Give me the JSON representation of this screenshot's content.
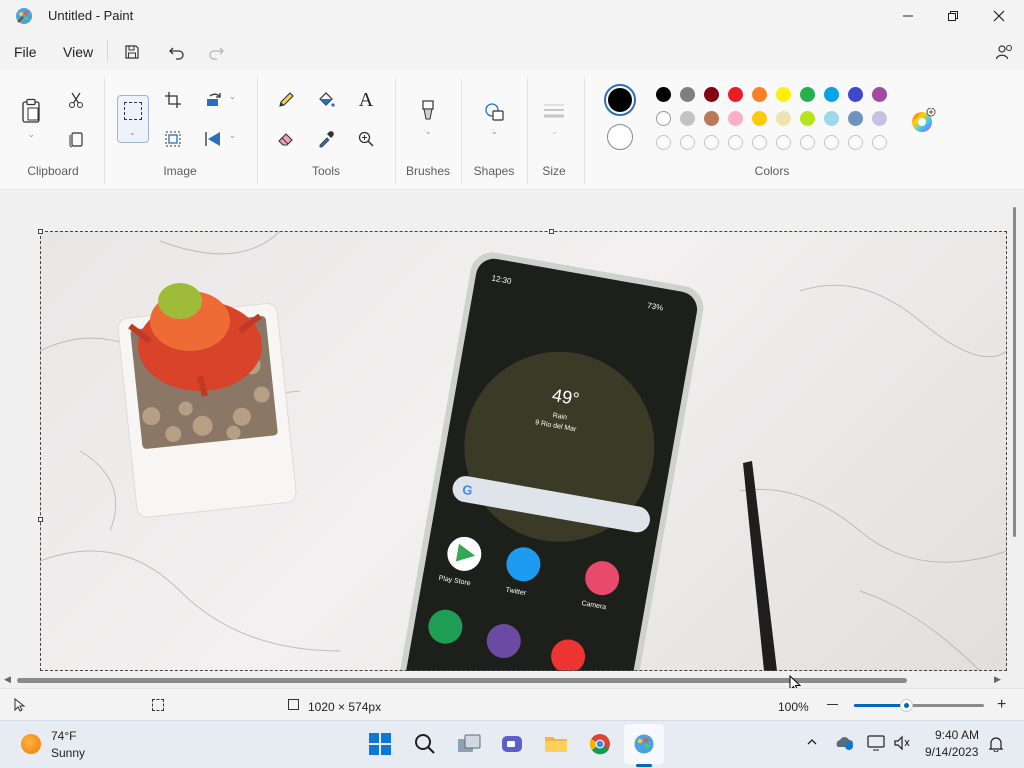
{
  "window": {
    "title": "Untitled - Paint"
  },
  "menu": {
    "file": "File",
    "view": "View"
  },
  "ribbon": {
    "groups": {
      "clipboard": "Clipboard",
      "image": "Image",
      "tools": "Tools",
      "brushes": "Brushes",
      "shapes": "Shapes",
      "size": "Size",
      "colors": "Colors"
    },
    "colors": {
      "primary": "#000000",
      "secondary": "#ffffff",
      "row1": [
        "#000000",
        "#7f7f7f",
        "#880015",
        "#ed1c24",
        "#ff7f27",
        "#fff200",
        "#22b14c",
        "#00a2e8",
        "#3f48cc",
        "#a349a4"
      ],
      "row2": [
        "#ffffff",
        "#c3c3c3",
        "#b97a57",
        "#ffaec9",
        "#ffc90e",
        "#efe4b0",
        "#b5e61d",
        "#99d9ea",
        "#7092be",
        "#c8bfe7"
      ]
    }
  },
  "canvas": {
    "phone": {
      "status_time": "12:30",
      "battery": "73%",
      "weather_temp": "49°",
      "weather_desc": "Rain",
      "weather_location": "9 Rio del Mar",
      "apps": [
        {
          "label": "Play Store",
          "color": "#ffffff"
        },
        {
          "label": "Twitter",
          "color": "#1d9bf0"
        },
        {
          "label": "Camera",
          "color": "#e84a6b"
        }
      ]
    }
  },
  "statusbar": {
    "canvas_size": "1020 × 574px",
    "zoom": "100%",
    "zoom_fraction": 0.4
  },
  "taskbar": {
    "weather_temp": "74°F",
    "weather_desc": "Sunny",
    "time": "9:40 AM",
    "date": "9/14/2023"
  }
}
